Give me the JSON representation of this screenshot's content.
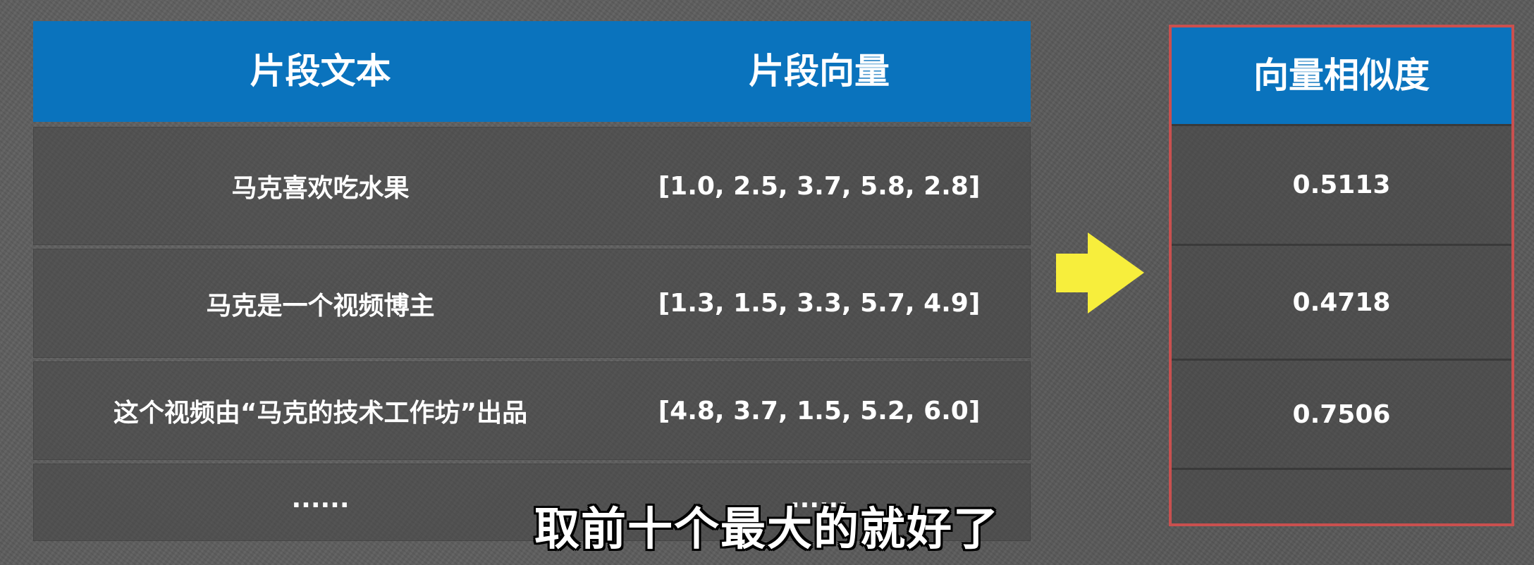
{
  "main_table": {
    "headers": [
      "片段文本",
      "片段向量"
    ],
    "rows": [
      {
        "text": "马克喜欢吃水果",
        "vector": "[1.0, 2.5, 3.7, 5.8, 2.8]"
      },
      {
        "text": "马克是一个视频博主",
        "vector": "[1.3, 1.5, 3.3, 5.7, 4.9]"
      },
      {
        "text": "这个视频由“马克的技术工作坊”出品",
        "vector": "[4.8, 3.7, 1.5, 5.2, 6.0]"
      },
      {
        "text": "......",
        "vector": "......"
      }
    ]
  },
  "arrow": {
    "icon": "right-arrow-icon",
    "color": "#f7ee3c"
  },
  "similarity_table": {
    "header": "向量相似度",
    "values": [
      "0.5113",
      "0.4718",
      "0.7506",
      ""
    ],
    "border_color": "#c9504f"
  },
  "subtitle": "取前十个最大的就好了",
  "colors": {
    "header_blue": "#0a73bd",
    "text": "#ffffff"
  }
}
